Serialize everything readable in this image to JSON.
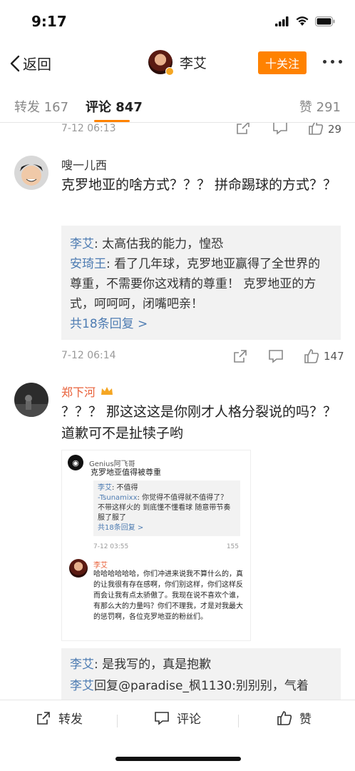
{
  "status_bar": {
    "time": "9:17"
  },
  "nav": {
    "back_label": "返回",
    "user_name": "李艾",
    "follow_label": "十关注"
  },
  "tabs": [
    {
      "label": "转发 167"
    },
    {
      "label": "评论 847"
    },
    {
      "label": "赞 291"
    }
  ],
  "prev_comment": {
    "time": "7-12 06:13",
    "likes": "29"
  },
  "comment1": {
    "user": "嗖一儿西",
    "text": "克罗地亚的啥方式？？？ 拼命踢球的方式？？",
    "replies": [
      {
        "who": "李艾",
        "text": ": 太高估我的能力，惶恐"
      },
      {
        "who": "安琦王",
        "text": ": 看了几年球，克罗地亚赢得了全世界的尊重，不需要你这戏精的尊重！ 克罗地亚的方式，呵呵呵，闭嘴吧亲！"
      }
    ],
    "more": "共18条回复 >",
    "time": "7-12 06:14",
    "likes": "147"
  },
  "comment2": {
    "user": "郑下河",
    "text": "？？？ 那这这这是你刚才人格分裂说的吗？？ 道歉可不是扯犊子哟",
    "shot": {
      "head_name": "Genius阿飞哥",
      "title": "克罗地亚值得被尊重",
      "reply1_who": "李艾",
      "reply1_text": ": 不值得",
      "reply2_who": "-Tsunamixx",
      "reply2_text": ": 你觉得不值得就不值得了？ 不带这样火的 到底懂不懂看球 随意带节奏 服了服了",
      "more": "共18条回复 >",
      "time": "7-12 03:55",
      "likes": "155",
      "name2": "李艾",
      "body": "哈哈哈哈哈哈，你们冲进来说我不算什么的，真的让我很有存在感啊，你们别这样，你们这样反而会让我有点太骄傲了。我现在说不喜欢个谁，有那么大的力量吗？你们不理我，才是对我最大的惩罚啊，各位克罗地亚的粉丝们。"
    },
    "replies": [
      {
        "who": "李艾",
        "text": ": 是我写的，真是抱歉"
      },
      {
        "who": "李艾",
        "text": "回复@paradise_枫1130:别别别，气着"
      }
    ]
  },
  "toolbar": {
    "repost": "转发",
    "comment": "评论",
    "like": "赞"
  }
}
